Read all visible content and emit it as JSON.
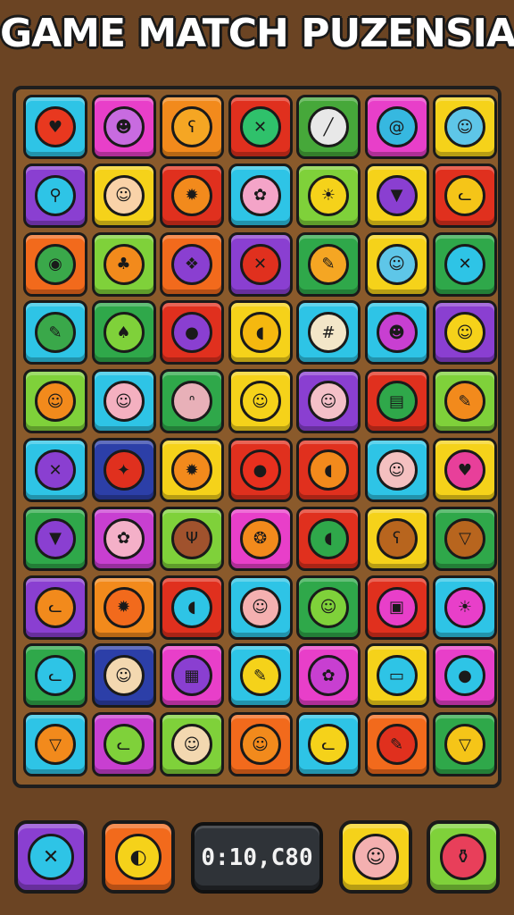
{
  "title": "GAME MATCH PUZENSIA",
  "timer": "0:10,C80",
  "tiles": [
    {
      "color": "#2ec4e6",
      "icon": "heart-icon",
      "accent": "#e8381f"
    },
    {
      "color": "#e83fc9",
      "icon": "monster-face-icon",
      "accent": "#c86be0"
    },
    {
      "color": "#f28a1c",
      "icon": "bear-face-icon",
      "accent": "#f5a623"
    },
    {
      "color": "#e0301e",
      "icon": "crossed-pencils-icon",
      "accent": "#2fc16b"
    },
    {
      "color": "#46a83a",
      "icon": "ruler-icon",
      "accent": "#e8e8e8"
    },
    {
      "color": "#e83fc9",
      "icon": "swirl-candy-icon",
      "accent": "#36b8e0"
    },
    {
      "color": "#f5d21a",
      "icon": "boy-face-icon",
      "accent": "#5ec6e8"
    },
    {
      "color": "#8a3fd1",
      "icon": "magnifier-icon",
      "accent": "#2ec4e6"
    },
    {
      "color": "#f5d21a",
      "icon": "smile-face-icon",
      "accent": "#f9d2a8"
    },
    {
      "color": "#e0301e",
      "icon": "lion-face-icon",
      "accent": "#f28a1c"
    },
    {
      "color": "#2ec4e6",
      "icon": "flower-face-icon",
      "accent": "#f4a4c8"
    },
    {
      "color": "#7fd13a",
      "icon": "sun-face-icon",
      "accent": "#f5d21a"
    },
    {
      "color": "#f5d21a",
      "icon": "shield-icon",
      "accent": "#8a3fd1"
    },
    {
      "color": "#e0301e",
      "icon": "cat-face-icon",
      "accent": "#f5c518"
    },
    {
      "color": "#f26a1c",
      "icon": "lollipop-icon",
      "accent": "#3aa84a"
    },
    {
      "color": "#7fd13a",
      "icon": "palm-tree-icon",
      "accent": "#f28a1c"
    },
    {
      "color": "#f26a1c",
      "icon": "corn-icon",
      "accent": "#8a3fd1"
    },
    {
      "color": "#8a3fd1",
      "icon": "crossed-pencils-icon",
      "accent": "#e0301e"
    },
    {
      "color": "#2fa84a",
      "icon": "pencil-icon",
      "accent": "#f5a623"
    },
    {
      "color": "#f5d21a",
      "icon": "girl-face-icon",
      "accent": "#5ec6e8"
    },
    {
      "color": "#2fa84a",
      "icon": "crossed-pencils-icon",
      "accent": "#2ec4e6"
    },
    {
      "color": "#2ec4e6",
      "icon": "leaf-pencil-icon",
      "accent": "#3aa84a"
    },
    {
      "color": "#2fa84a",
      "icon": "bamboo-icon",
      "accent": "#7fd13a"
    },
    {
      "color": "#e0301e",
      "icon": "balloon-icon",
      "accent": "#8a3fd1"
    },
    {
      "color": "#f5d21a",
      "icon": "speech-bubble-icon",
      "accent": "#f5b80f"
    },
    {
      "color": "#2ec4e6",
      "icon": "fly-swatter-icon",
      "accent": "#f3e6c8"
    },
    {
      "color": "#2ec4e6",
      "icon": "monster-face-icon",
      "accent": "#c83fd1"
    },
    {
      "color": "#8a3fd1",
      "icon": "girl-face-icon",
      "accent": "#f5d21a"
    },
    {
      "color": "#7fd13a",
      "icon": "monkey-face-icon",
      "accent": "#f28a1c"
    },
    {
      "color": "#2ec4e6",
      "icon": "baby-face-icon",
      "accent": "#f4b0c0"
    },
    {
      "color": "#2fa84a",
      "icon": "bunny-face-icon",
      "accent": "#e8b0b8"
    },
    {
      "color": "#f5d21a",
      "icon": "boy-face-icon",
      "accent": "#f5d21a"
    },
    {
      "color": "#8a3fd1",
      "icon": "girl-face-icon",
      "accent": "#f4c0c8"
    },
    {
      "color": "#e0301e",
      "icon": "book-icon",
      "accent": "#2fa84a"
    },
    {
      "color": "#7fd13a",
      "icon": "pencil-icon",
      "accent": "#f28a1c"
    },
    {
      "color": "#2ec4e6",
      "icon": "crossed-pencils-icon",
      "accent": "#8a3fd1"
    },
    {
      "color": "#2c3fa8",
      "icon": "star-burst-icon",
      "accent": "#e0301e"
    },
    {
      "color": "#f5d21a",
      "icon": "lion-face-icon",
      "accent": "#f28a1c"
    },
    {
      "color": "#e0301e",
      "icon": "tomato-icon",
      "accent": "#e8301e"
    },
    {
      "color": "#e0301e",
      "icon": "speech-bubble-icon",
      "accent": "#f28a1c"
    },
    {
      "color": "#2ec4e6",
      "icon": "baby-face-icon",
      "accent": "#f4c0c0"
    },
    {
      "color": "#f5d21a",
      "icon": "heart-icon",
      "accent": "#e83f9a"
    },
    {
      "color": "#2fa84a",
      "icon": "shield-icon",
      "accent": "#8a3fd1"
    },
    {
      "color": "#c83fd1",
      "icon": "flower-face-icon",
      "accent": "#f4b0c8"
    },
    {
      "color": "#7fd13a",
      "icon": "deer-face-icon",
      "accent": "#a0522d"
    },
    {
      "color": "#e83fc9",
      "icon": "shell-icon",
      "accent": "#f28a1c"
    },
    {
      "color": "#e0301e",
      "icon": "speech-bubble-icon",
      "accent": "#2fa84a"
    },
    {
      "color": "#f5d21a",
      "icon": "bear-face-icon",
      "accent": "#b8651e"
    },
    {
      "color": "#2fa84a",
      "icon": "fox-face-icon",
      "accent": "#b8651e"
    },
    {
      "color": "#8a3fd1",
      "icon": "cat-face-icon",
      "accent": "#f28a1c"
    },
    {
      "color": "#f28a1c",
      "icon": "lion-face-icon",
      "accent": "#f26a1c"
    },
    {
      "color": "#e0301e",
      "icon": "speech-bubble-icon",
      "accent": "#2ec4e6"
    },
    {
      "color": "#2ec4e6",
      "icon": "baby-face-icon",
      "accent": "#f4b0b0"
    },
    {
      "color": "#2fa84a",
      "icon": "alien-face-icon",
      "accent": "#7fd13a"
    },
    {
      "color": "#e0301e",
      "icon": "briefcase-icon",
      "accent": "#e83fc9"
    },
    {
      "color": "#2ec4e6",
      "icon": "sun-face-icon",
      "accent": "#e83fc9"
    },
    {
      "color": "#2fa84a",
      "icon": "cat-face-icon",
      "accent": "#2ec4e6"
    },
    {
      "color": "#2c3fa8",
      "icon": "dog-face-icon",
      "accent": "#f3d8b0"
    },
    {
      "color": "#e83fc9",
      "icon": "game-board-icon",
      "accent": "#8a3fd1"
    },
    {
      "color": "#2ec4e6",
      "icon": "pencil-icon",
      "accent": "#f5d21a"
    },
    {
      "color": "#e83fc9",
      "icon": "flower-face-icon",
      "accent": "#c83fd1"
    },
    {
      "color": "#f5d21a",
      "icon": "sign-board-icon",
      "accent": "#2ec4e6"
    },
    {
      "color": "#e83fc9",
      "icon": "balloon-icon",
      "accent": "#2ec4e6"
    },
    {
      "color": "#2ec4e6",
      "icon": "fox-face-icon",
      "accent": "#f28a1c"
    },
    {
      "color": "#c83fd1",
      "icon": "cat-face-icon",
      "accent": "#7fd13a"
    },
    {
      "color": "#7fd13a",
      "icon": "boy-face-icon",
      "accent": "#f3d8b0"
    },
    {
      "color": "#f26a1c",
      "icon": "monkey-face-icon",
      "accent": "#f28a1c"
    },
    {
      "color": "#2ec4e6",
      "icon": "cat-face-icon",
      "accent": "#f5d21a"
    },
    {
      "color": "#f26a1c",
      "icon": "pin-icon",
      "accent": "#e0301e"
    },
    {
      "color": "#2fa84a",
      "icon": "fox-face-icon",
      "accent": "#f5c518"
    }
  ],
  "footer": {
    "left_buttons": [
      {
        "color": "#8a3fd1",
        "icon": "crossed-pencils-icon",
        "accent": "#2ec4e6"
      },
      {
        "color": "#f26a1c",
        "icon": "egg-bubble-icon",
        "accent": "#f5d21a"
      }
    ],
    "right_buttons": [
      {
        "color": "#f5d21a",
        "icon": "baby-face-icon",
        "accent": "#f4b0b0"
      },
      {
        "color": "#7fd13a",
        "icon": "potion-jar-icon",
        "accent": "#e83f5a"
      }
    ]
  }
}
